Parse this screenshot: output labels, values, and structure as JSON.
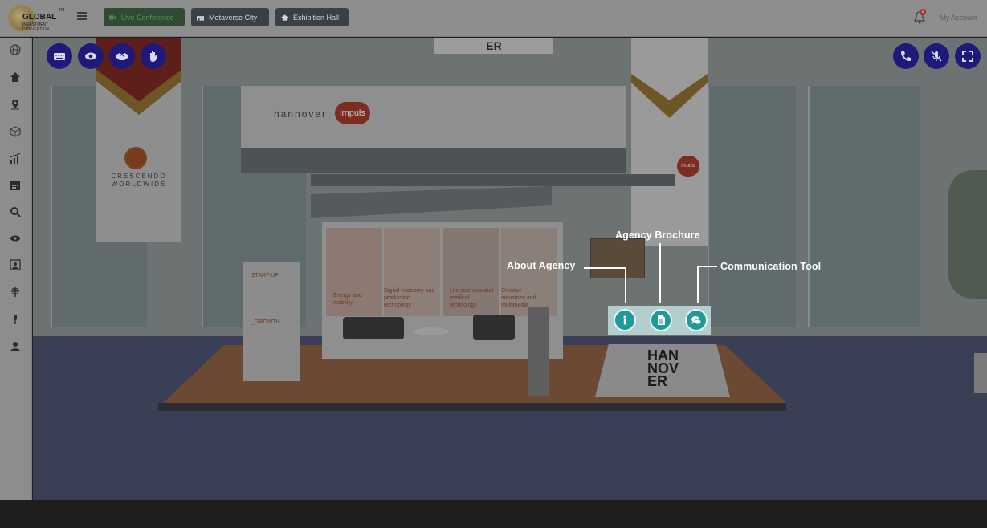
{
  "header": {
    "logo_text": "GLOBAL",
    "logo_subtext": "INVESTMENT\nCONVENTION",
    "logo_tm": "TM",
    "nav": [
      {
        "label": "Live Conference",
        "icon": "video-icon",
        "active": true
      },
      {
        "label": "Metaverse City",
        "icon": "city-icon",
        "active": false
      },
      {
        "label": "Exhibition Hall",
        "icon": "home-icon",
        "active": false
      }
    ],
    "notification_count": "0",
    "account_label": "My Account"
  },
  "sidebar": {
    "items": [
      {
        "icon": "globe-icon"
      },
      {
        "icon": "home-icon"
      },
      {
        "icon": "map-pin-icon"
      },
      {
        "icon": "cube-icon"
      },
      {
        "icon": "chart-icon"
      },
      {
        "icon": "calendar-icon"
      },
      {
        "icon": "search-icon"
      },
      {
        "icon": "eye-icon"
      },
      {
        "icon": "profile-card-icon"
      },
      {
        "icon": "stack-icon"
      },
      {
        "icon": "microphone-icon"
      },
      {
        "icon": "user-icon"
      }
    ]
  },
  "scene": {
    "banner_left_text": "CRESCENDO\nWORLDWIDE",
    "canopy_brand": "hannover",
    "canopy_brand_badge": "impuls",
    "roof_sign": "ER",
    "podium_text": "HAN\nNOV\nER",
    "standee_top": "_START-UP",
    "standee_bottom": "_GROWTH",
    "wall_captions": [
      "Energy and mobility",
      "Digital economy and production technology",
      "Life sciences and medical technology",
      "Creative industries and multimedia"
    ],
    "side_badge": "impuls"
  },
  "controls": {
    "left": [
      "keyboard-icon",
      "eye-icon",
      "handshake-icon",
      "hand-icon"
    ],
    "right": [
      "phone-icon",
      "mic-off-icon",
      "fullscreen-icon"
    ]
  },
  "booth_tools": {
    "about": {
      "label": "About Agency",
      "icon": "info-icon"
    },
    "brochure": {
      "label": "Agency Brochure",
      "icon": "document-icon"
    },
    "communication": {
      "label": "Communication Tool",
      "icon": "chat-icon"
    }
  },
  "colors": {
    "control_button": "#1d1a7b",
    "tool_button": "#1e9a98",
    "active_nav": "#2f4a35",
    "nav_button": "#3a4047"
  }
}
